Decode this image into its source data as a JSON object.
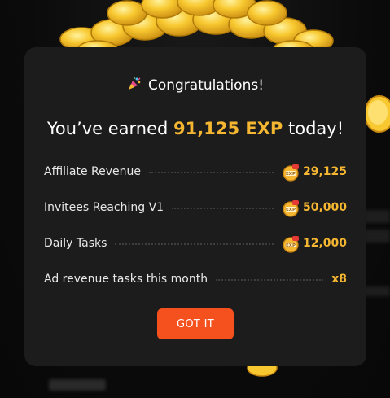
{
  "modal": {
    "header_icon": "party-popper-icon",
    "header": "Congratulations!",
    "earned_prefix": "You’ve earned ",
    "earned_amount": "91,125 EXP",
    "earned_suffix": " today!",
    "rows": [
      {
        "label": "Affiliate Revenue",
        "icon": "exp-coin-icon",
        "value": "29,125"
      },
      {
        "label": "Invitees Reaching V1",
        "icon": "exp-coin-icon",
        "value": "50,000"
      },
      {
        "label": "Daily Tasks",
        "icon": "exp-coin-icon",
        "value": "12,000"
      },
      {
        "label": "Ad revenue tasks this month",
        "icon": null,
        "value": "x8"
      }
    ],
    "button_label": "GOT IT"
  },
  "colors": {
    "accent_gold": "#f5b731",
    "button_orange": "#f4511e",
    "modal_bg": "#1c1c1c",
    "page_bg": "#0d0d0d"
  }
}
